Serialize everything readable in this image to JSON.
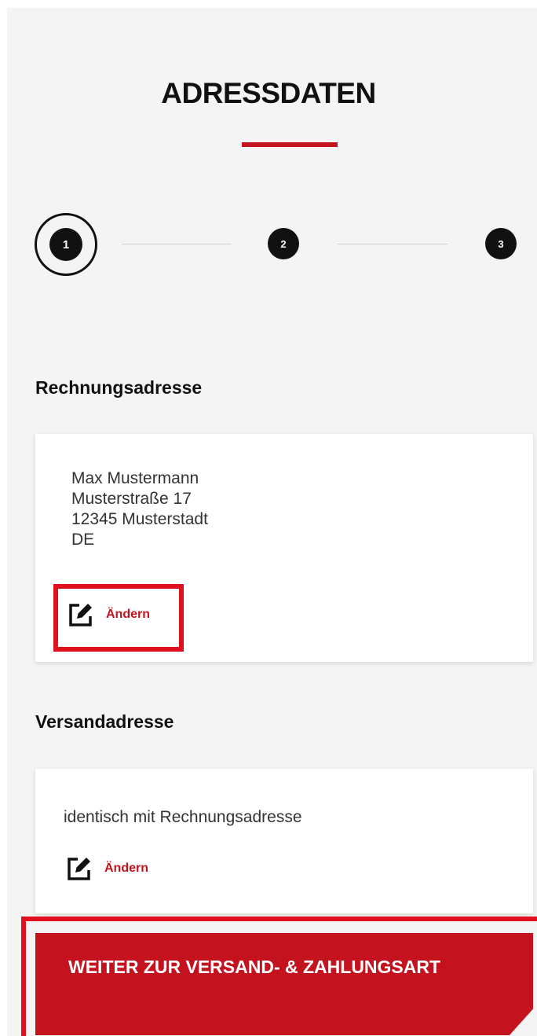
{
  "page": {
    "title": "ADRESSDATEN",
    "accent_color": "#c4121f"
  },
  "stepper": {
    "steps": [
      "1",
      "2",
      "3"
    ],
    "active_step": 1
  },
  "billing": {
    "heading": "Rechnungsadresse",
    "address_lines": [
      "Max Mustermann",
      "Musterstraße 17",
      "12345 Musterstadt",
      "DE"
    ],
    "edit_label": "Ändern",
    "edit_icon": "edit-icon"
  },
  "shipping": {
    "heading": "Versandadresse",
    "text": "identisch mit Rechnungsadresse",
    "edit_label": "Ändern",
    "edit_icon": "edit-icon"
  },
  "cta": {
    "label": "WEITER ZUR VERSAND- & ZAHLUNGSART"
  }
}
